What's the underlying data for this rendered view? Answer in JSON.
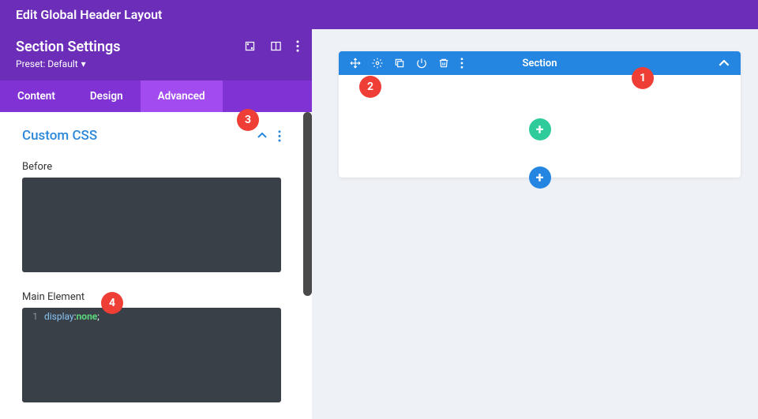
{
  "topbar": {
    "title": "Edit Global Header Layout"
  },
  "settings": {
    "title": "Section Settings",
    "preset_label": "Preset: Default"
  },
  "tabs": {
    "content": "Content",
    "design": "Design",
    "advanced": "Advanced"
  },
  "panel": {
    "title": "Custom CSS",
    "before_label": "Before",
    "main_label": "Main Element",
    "code_line_num": "1",
    "code_prop": "display",
    "code_colon": ":",
    "code_val": "none",
    "code_semi": ";"
  },
  "canvas": {
    "section_label": "Section",
    "plus": "+"
  },
  "annotations": {
    "a1": "1",
    "a2": "2",
    "a3": "3",
    "a4": "4"
  }
}
